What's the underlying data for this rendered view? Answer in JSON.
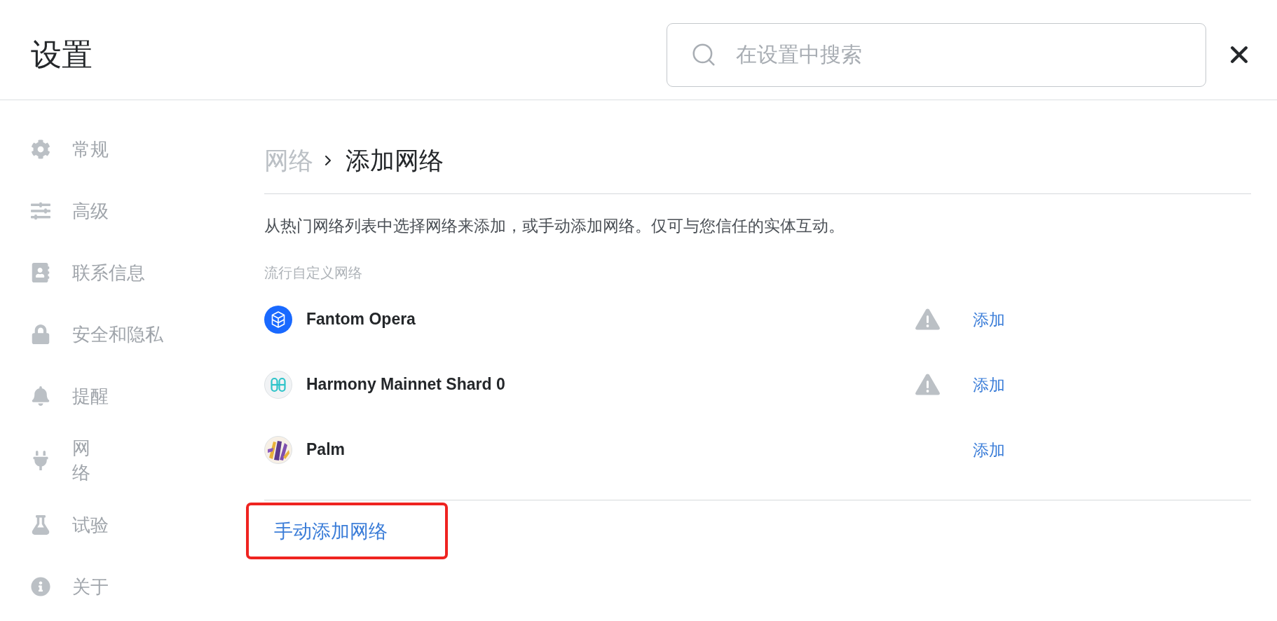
{
  "header": {
    "title": "设置",
    "search": {
      "placeholder": "在设置中搜索"
    }
  },
  "sidebar": {
    "items": [
      {
        "label": "常规",
        "kind": "gear",
        "selected": false,
        "wrapped": false
      },
      {
        "label": "高级",
        "kind": "sliders",
        "selected": false,
        "wrapped": false
      },
      {
        "label": "联系信息",
        "kind": "contact",
        "selected": false,
        "wrapped": false
      },
      {
        "label": "安全和隐私",
        "kind": "lock",
        "selected": false,
        "wrapped": false
      },
      {
        "label": "提醒",
        "kind": "bell",
        "selected": false,
        "wrapped": false
      },
      {
        "label": "网络",
        "kind": "plug",
        "selected": false,
        "wrapped": true
      },
      {
        "label": "试验",
        "kind": "flask",
        "selected": false,
        "wrapped": false
      },
      {
        "label": "关于",
        "kind": "info",
        "selected": false,
        "wrapped": false
      }
    ]
  },
  "breadcrumb": [
    {
      "label": "网络",
      "current": false
    },
    {
      "label": "添加网络",
      "current": true
    }
  ],
  "description": "从热门网络列表中选择网络来添加，或手动添加网络。仅可与您信任的实体互动。",
  "popular_networks": {
    "heading": "流行自定义网络",
    "items": [
      {
        "name": "Fantom Opera",
        "kind": "cube",
        "warning": true,
        "action": "添加"
      },
      {
        "name": "Harmony Mainnet Shard 0",
        "kind": "loops",
        "warning": true,
        "action": "添加"
      },
      {
        "name": "Palm",
        "kind": "fronds",
        "warning": false,
        "action": "添加"
      }
    ]
  },
  "manual_add": {
    "label": "手动添加网络",
    "highlighted": true
  }
}
